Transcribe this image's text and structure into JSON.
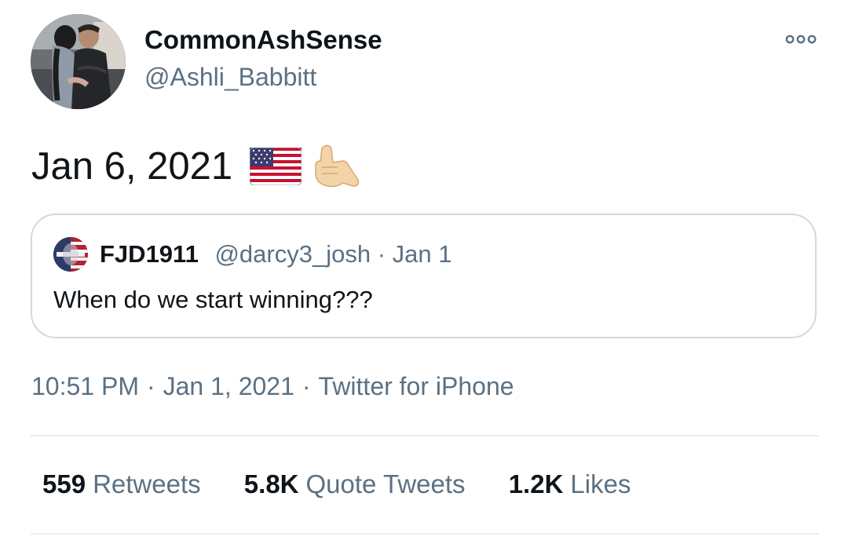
{
  "author": {
    "display_name": "CommonAshSense",
    "handle": "@Ashli_Babbitt",
    "avatar_icon": "profile-photo"
  },
  "more_icon": "more-options-icon",
  "tweet": {
    "text": "Jan 6, 2021",
    "emojis": [
      "us-flag-emoji",
      "call-me-hand-emoji"
    ]
  },
  "quoted_tweet": {
    "display_name": "FJD1911",
    "handle": "@darcy3_josh",
    "separator": "·",
    "date": "Jan 1",
    "text": "When do we start winning???",
    "avatar_icon": "flag-avatar"
  },
  "meta": {
    "time": "10:51 PM",
    "separator": "·",
    "date": "Jan 1, 2021",
    "separator2": "·",
    "source": "Twitter for iPhone"
  },
  "stats": {
    "retweets_count": "559",
    "retweets_label": "Retweets",
    "quotes_count": "5.8K",
    "quotes_label": "Quote Tweets",
    "likes_count": "1.2K",
    "likes_label": "Likes"
  },
  "colors": {
    "text_primary": "#0f1419",
    "text_secondary": "#5b7083",
    "border": "#cfd9de",
    "divider": "#e7ecf0"
  }
}
